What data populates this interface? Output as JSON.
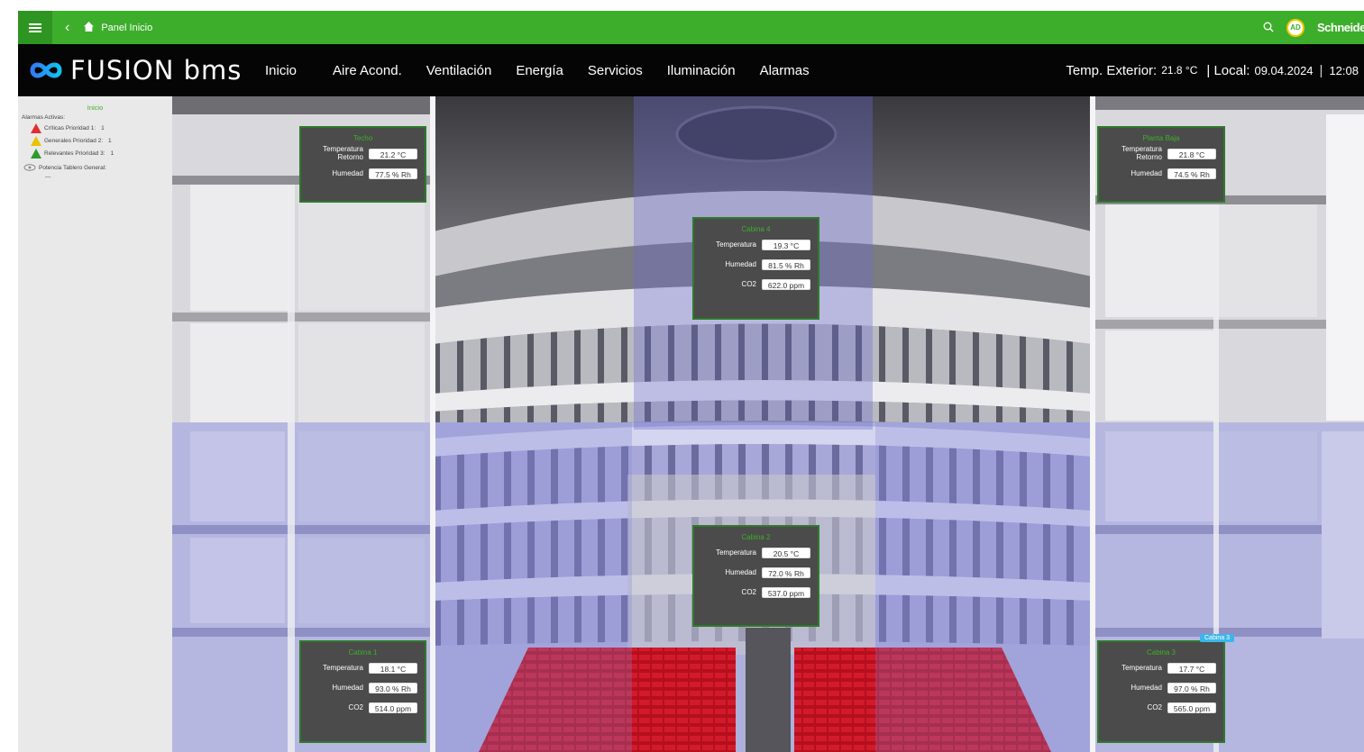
{
  "topbar": {
    "breadcrumb": "Panel Inicio",
    "brand": "Schneider",
    "avatar_initials": "AD",
    "icons": [
      "menu-icon",
      "chevron-left-icon",
      "home-icon",
      "search-icon"
    ]
  },
  "logo": {
    "text": "FUSION bms"
  },
  "nav": {
    "items": [
      "Inicio",
      "Aire Acond.",
      "Ventilación",
      "Energía",
      "Servicios",
      "Iluminación",
      "Alarmas"
    ]
  },
  "status": {
    "temp_label": "Temp. Exterior:",
    "temp_value": "21.8 °C",
    "local_label": "| Local:",
    "date": "09.04.2024",
    "time": "12:08"
  },
  "sidebar": {
    "title": "Inicio",
    "alarms_label": "Alarmas Activas:",
    "alarms": [
      {
        "label": "Críticas Prioridad 1:",
        "count": "1",
        "color": "#e03030"
      },
      {
        "label": "Generales Prioridad 2:",
        "count": "1",
        "color": "#e8c400"
      },
      {
        "label": "Relevantes Prioridad 3:",
        "count": "1",
        "color": "#2f9a2f"
      }
    ],
    "power_label": "Potencia Tablero General:",
    "power_value": "---"
  },
  "zones": {
    "techo": {
      "title": "Techo",
      "temp_label": "Temperatura Retorno",
      "temp": "21.2 °C",
      "hum_label": "Humedad",
      "hum": "77.5 % Rh"
    },
    "planta_baja": {
      "title": "Planta Baja",
      "temp_label": "Temperatura Retorno",
      "temp": "21.8 °C",
      "hum_label": "Humedad",
      "hum": "74.5 % Rh"
    },
    "cabina4": {
      "title": "Cabina 4",
      "temp_label": "Temperatura",
      "temp": "19.3 °C",
      "hum_label": "Humedad",
      "hum": "81.5 % Rh",
      "co2_label": "CO2",
      "co2": "622.0 ppm"
    },
    "cabina2": {
      "title": "Cabina 2",
      "temp_label": "Temperatura",
      "temp": "20.5 °C",
      "hum_label": "Humedad",
      "hum": "72.0 % Rh",
      "co2_label": "CO2",
      "co2": "537.0 ppm"
    },
    "cabina1": {
      "title": "Cabina 1",
      "temp_label": "Temperatura",
      "temp": "18.1 °C",
      "hum_label": "Humedad",
      "hum": "93.0 % Rh",
      "co2_label": "CO2",
      "co2": "514.0 ppm"
    },
    "cabina3": {
      "title": "Cabina 3",
      "temp_label": "Temperatura",
      "temp": "17.7 °C",
      "hum_label": "Humedad",
      "hum": "97.0 % Rh",
      "co2_label": "CO2",
      "co2": "565.0 ppm",
      "tag": "Cabina 3"
    }
  }
}
